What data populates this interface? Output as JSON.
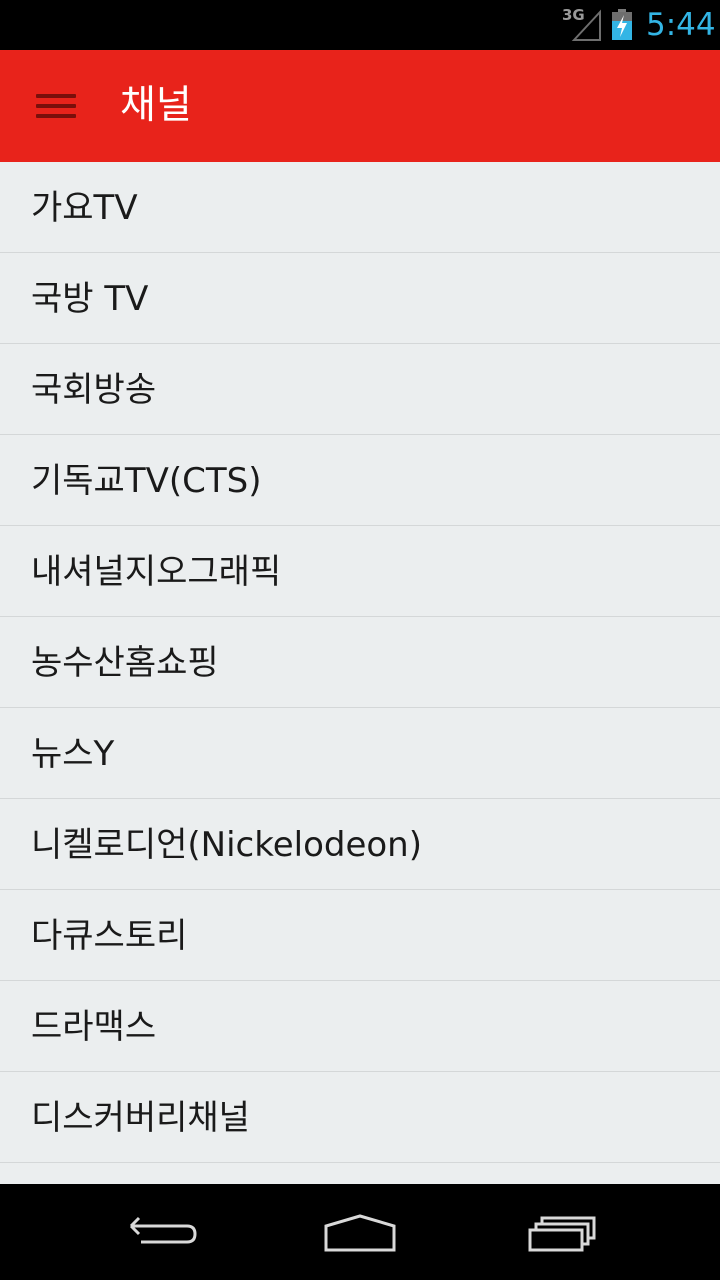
{
  "status_bar": {
    "network": "3G",
    "time": "5:44",
    "icons": [
      "signal-icon",
      "battery-charging-icon"
    ]
  },
  "app_bar": {
    "title": "채널",
    "menu_icon": "hamburger-menu-icon",
    "background_color": "#e8231b"
  },
  "channels": [
    {
      "label": "가요TV"
    },
    {
      "label": "국방 TV"
    },
    {
      "label": "국회방송"
    },
    {
      "label": "기독교TV(CTS)"
    },
    {
      "label": "내셔널지오그래픽"
    },
    {
      "label": "농수산홈쇼핑"
    },
    {
      "label": "뉴스Y"
    },
    {
      "label": "니켈로디언(Nickelodeon)"
    },
    {
      "label": "다큐스토리"
    },
    {
      "label": "드라맥스"
    },
    {
      "label": "디스커버리채널"
    }
  ],
  "nav_bar": {
    "buttons": [
      "back-icon",
      "home-icon",
      "recent-apps-icon"
    ]
  },
  "colors": {
    "accent": "#e8231b",
    "clock": "#33b5e5",
    "list_background": "#ebeeef",
    "divider": "#d4d7d8"
  }
}
